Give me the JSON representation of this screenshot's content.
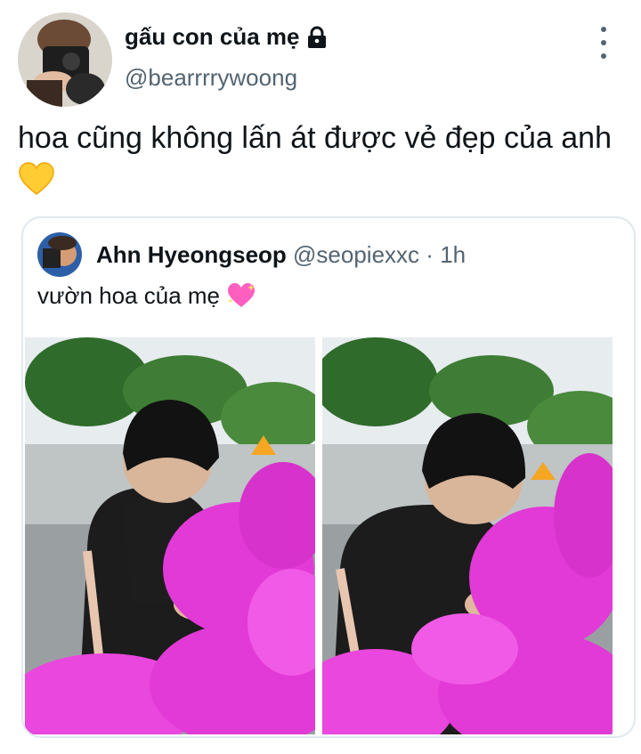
{
  "tweet": {
    "author": {
      "display_name": "gấu con của mẹ",
      "handle": "@bearrrrywoong",
      "protected_icon": "lock-icon",
      "avatar_icon": "avatar-photo"
    },
    "text": "hoa cũng không lấn át được vẻ đẹp của anh",
    "emoji": "yellow-heart-emoji",
    "more_icon": "more-vertical-icon"
  },
  "quoted_tweet": {
    "author": {
      "display_name": "Ahn Hyeongseop",
      "handle": "@seopiexxc",
      "separator": "·",
      "time": "1h",
      "avatar_icon": "avatar-photo"
    },
    "text": "vườn hoa của mẹ",
    "emoji": "sparkling-heart-emoji",
    "photos": [
      {
        "subject": "man smelling pink azalea flowers"
      },
      {
        "subject": "man smelling pink azalea flowers close-up"
      }
    ]
  },
  "colors": {
    "text_primary": "#0f1419",
    "text_secondary": "#536471",
    "border": "#e1e8ed",
    "flower_pink": "#e23ad6",
    "heart_yellow": "#ffcc33"
  }
}
